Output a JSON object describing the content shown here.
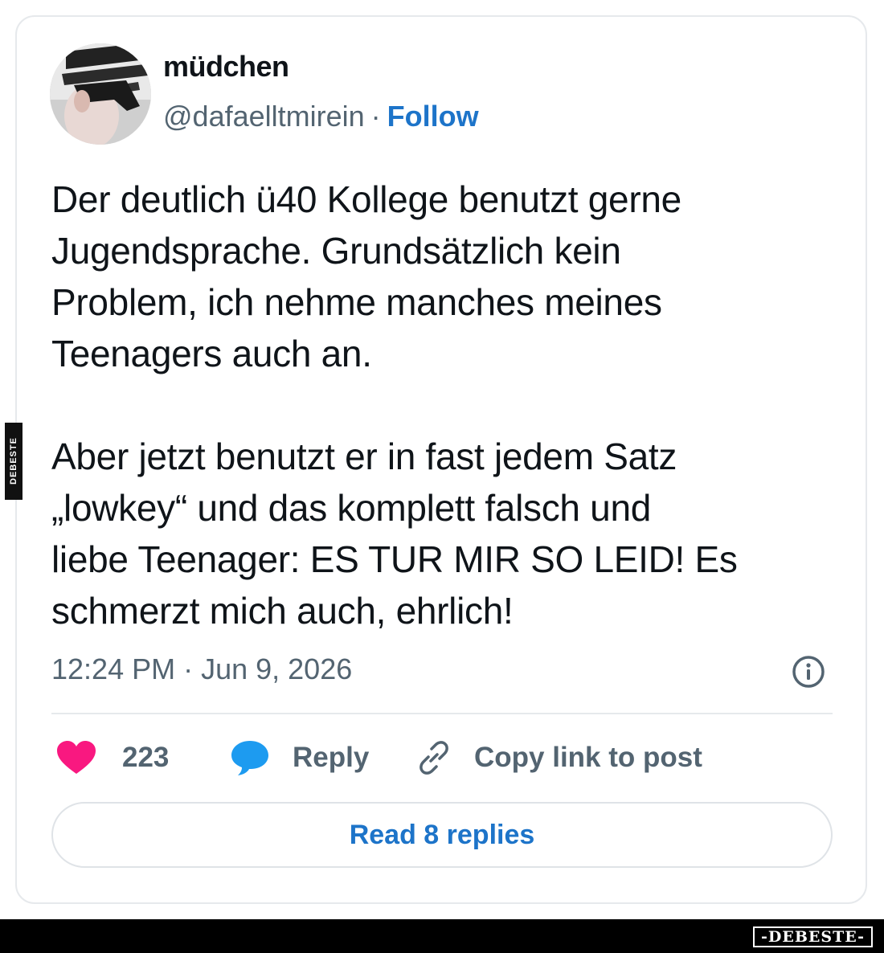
{
  "author": {
    "display_name": "müdchen",
    "handle": "@dafaelltmirein",
    "separator": "·",
    "follow_label": "Follow"
  },
  "tweet": {
    "text": "Der deutlich ü40 Kollege benutzt gerne\nJugendsprache. Grundsätzlich kein\nProblem, ich nehme manches meines\nTeenagers auch an.\n\nAber jetzt benutzt er in fast jedem Satz\n„lowkey“ und das komplett falsch und\nliebe Teenager: ES TUR MIR SO LEID! Es\nschmerzt mich auch, ehrlich!",
    "timestamp": "12:24 PM · Jun 9, 2026"
  },
  "actions": {
    "like_count": "223",
    "reply_label": "Reply",
    "copy_link_label": "Copy link to post"
  },
  "read_replies_label": "Read 8 replies",
  "watermark": {
    "side": "DEBESTE",
    "footer": "-DEBESTE-"
  },
  "icons": {
    "like": "heart-icon",
    "reply": "speech-bubble-icon",
    "copy_link": "link-icon",
    "info": "info-icon"
  },
  "colors": {
    "accent": "#1d74c9",
    "like": "#f91880",
    "reply_icon": "#1d9bf0",
    "muted_text": "#536471",
    "text": "#0f1419"
  }
}
